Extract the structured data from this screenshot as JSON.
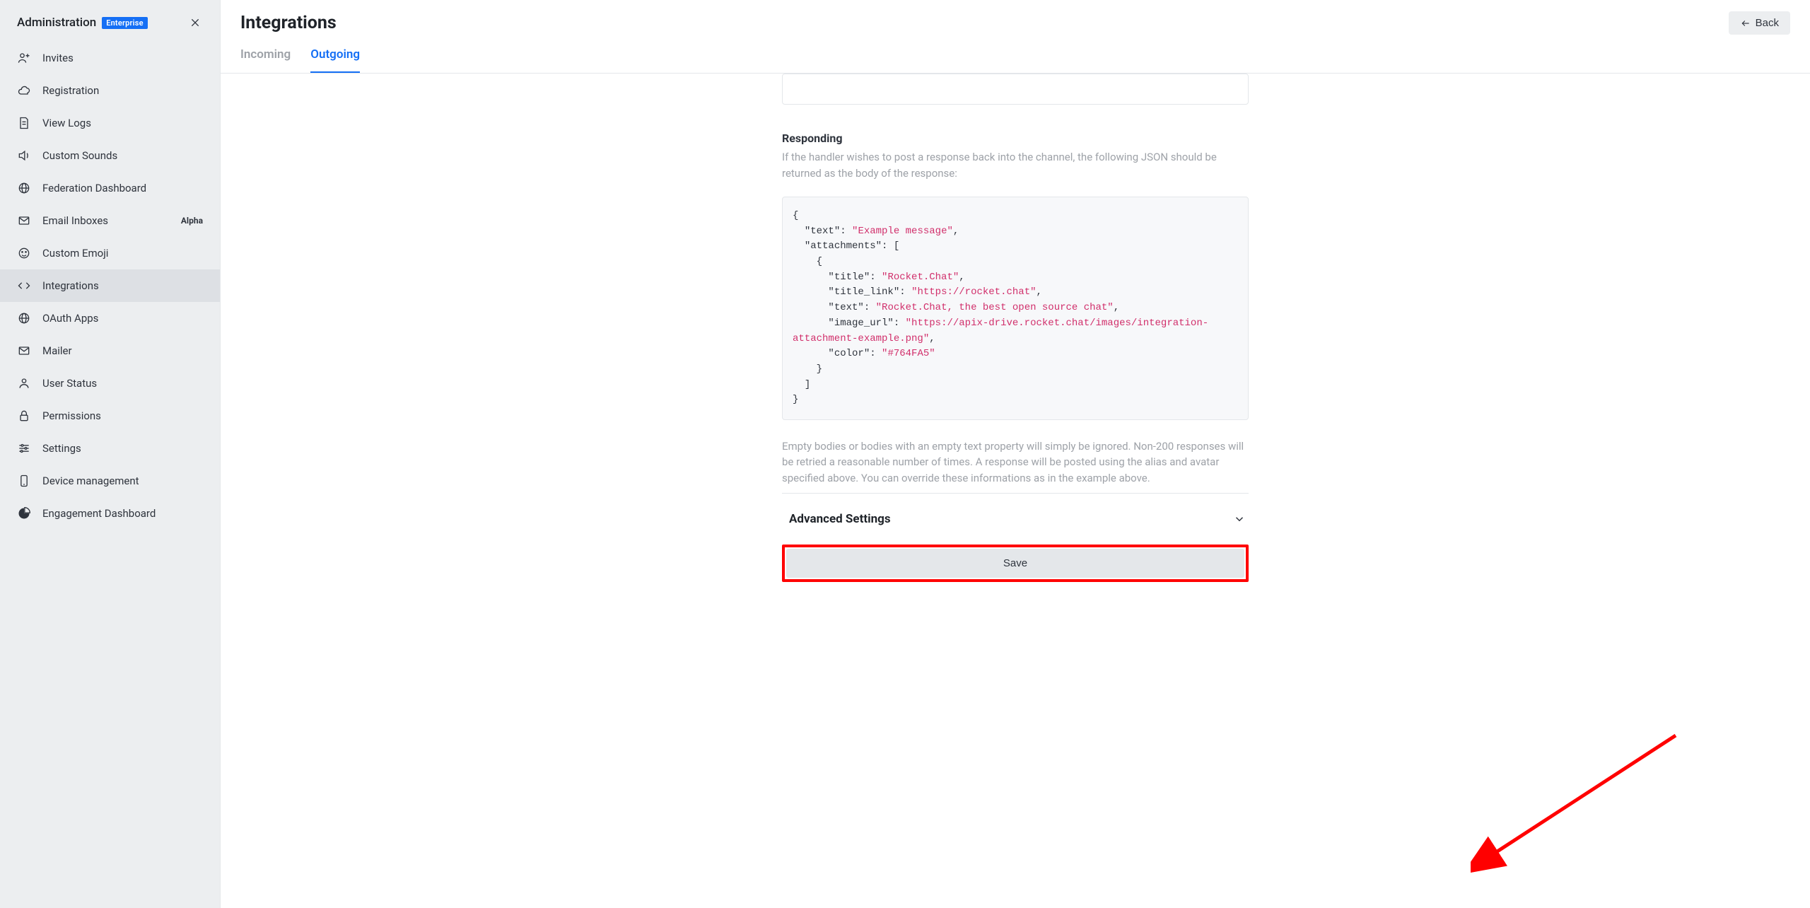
{
  "sidebar": {
    "title": "Administration",
    "badge": "Enterprise",
    "items": [
      {
        "icon": "user-plus-icon",
        "label": "Invites"
      },
      {
        "icon": "cloud-icon",
        "label": "Registration"
      },
      {
        "icon": "file-icon",
        "label": "View Logs"
      },
      {
        "icon": "sound-icon",
        "label": "Custom Sounds"
      },
      {
        "icon": "globe-icon",
        "label": "Federation Dashboard"
      },
      {
        "icon": "mail-icon",
        "label": "Email Inboxes",
        "tag": "Alpha"
      },
      {
        "icon": "emoji-icon",
        "label": "Custom Emoji"
      },
      {
        "icon": "code-icon",
        "label": "Integrations",
        "active": true
      },
      {
        "icon": "globe-icon",
        "label": "OAuth Apps"
      },
      {
        "icon": "mail-icon",
        "label": "Mailer"
      },
      {
        "icon": "user-icon",
        "label": "User Status"
      },
      {
        "icon": "lock-icon",
        "label": "Permissions"
      },
      {
        "icon": "sliders-icon",
        "label": "Settings"
      },
      {
        "icon": "device-icon",
        "label": "Device management"
      },
      {
        "icon": "piechart-icon",
        "label": "Engagement Dashboard"
      }
    ]
  },
  "page": {
    "title": "Integrations",
    "back_label": "Back",
    "tabs": [
      {
        "label": "Incoming",
        "active": false
      },
      {
        "label": "Outgoing",
        "active": true
      }
    ]
  },
  "section": {
    "responding_title": "Responding",
    "responding_desc": "If the handler wishes to post a response back into the channel, the following JSON should be returned as the body of the response:",
    "note": "Empty bodies or bodies with an empty text property will simply be ignored. Non-200 responses will be retried a reasonable number of times. A response will be posted using the alias and avatar specified above. You can override these informations as in the example above.",
    "advanced_title": "Advanced Settings",
    "save_label": "Save"
  },
  "code": {
    "text_key": "\"text\"",
    "text_val": "\"Example message\"",
    "attachments_key": "\"attachments\"",
    "title_key": "\"title\"",
    "title_val": "\"Rocket.Chat\"",
    "title_link_key": "\"title_link\"",
    "title_link_val": "\"https://rocket.chat\"",
    "inner_text_key": "\"text\"",
    "inner_text_val": "\"Rocket.Chat, the best open source chat\"",
    "image_url_key": "\"image_url\"",
    "image_url_val": "\"https://apix-drive.rocket.chat/images/integration-attachment-example.png\"",
    "color_key": "\"color\"",
    "color_val": "\"#764FA5\""
  },
  "annotation": {
    "arrow_color": "#ff0000"
  }
}
